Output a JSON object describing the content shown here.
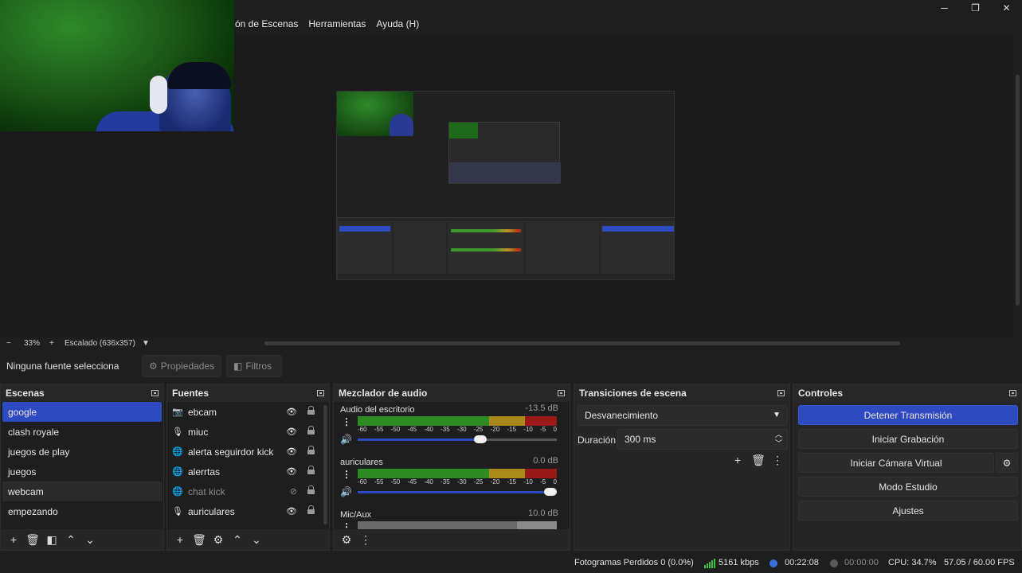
{
  "menu": {
    "items": [
      "ón de Escenas",
      "Herramientas",
      "Ayuda (H)"
    ]
  },
  "window_controls": {
    "minimize": "─",
    "restore": "❐",
    "close": "✕"
  },
  "zoom": {
    "minus": "−",
    "level": "33%",
    "plus": "+",
    "scaling": "Escalado (636x357)"
  },
  "source_toolbar": {
    "no_selection": "Ninguna fuente selecciona",
    "properties": "Propiedades",
    "filters": "Filtros"
  },
  "scenes": {
    "title": "Escenas",
    "items": [
      "google",
      "clash royale",
      "juegos de play",
      "juegos",
      "webcam",
      "empezando"
    ],
    "active_index": 0
  },
  "sources": {
    "title": "Fuentes",
    "items": [
      {
        "name": "ebcam",
        "icon": "camera-icon",
        "visible": true
      },
      {
        "name": "miuc",
        "icon": "microphone-icon",
        "visible": true
      },
      {
        "name": "alerta seguirdor kick",
        "icon": "browser-icon",
        "visible": true
      },
      {
        "name": "alerrtas",
        "icon": "browser-icon",
        "visible": true
      },
      {
        "name": "chat kick",
        "icon": "browser-icon",
        "visible": false
      },
      {
        "name": "auriculares",
        "icon": "microphone-icon",
        "visible": true
      }
    ]
  },
  "mixer": {
    "title": "Mezclador de audio",
    "ticks": [
      "-60",
      "-55",
      "-50",
      "-45",
      "-40",
      "-35",
      "-30",
      "-25",
      "-20",
      "-15",
      "-10",
      "-5",
      "0"
    ],
    "channels": [
      {
        "name": "Audio del escritorio",
        "db": "-13.5 dB",
        "fader": 0.6
      },
      {
        "name": "auriculares",
        "db": "0.0 dB",
        "fader": 1.0
      },
      {
        "name": "Mic/Aux",
        "db": "10.0 dB"
      }
    ]
  },
  "transitions": {
    "title": "Transiciones de escena",
    "selected": "Desvanecimiento",
    "duration_label": "Duración",
    "duration_value": "300 ms"
  },
  "controls": {
    "title": "Controles",
    "stop_stream": "Detener Transmisión",
    "start_recording": "Iniciar Grabación",
    "start_virtual_cam": "Iniciar Cámara Virtual",
    "studio_mode": "Modo Estudio",
    "settings": "Ajustes"
  },
  "status": {
    "dropped_frames": "Fotogramas Perdidos 0 (0.0%)",
    "bitrate": "5161 kbps",
    "stream_time": "00:22:08",
    "record_time": "00:00:00",
    "cpu": "CPU: 34.7%",
    "fps": "57.05 / 60.00 FPS"
  },
  "colors": {
    "accent": "#2d4ac0",
    "background": "#1e1e1e",
    "panel": "#262626",
    "meter_green": "#2e8a22",
    "meter_yellow": "#a98a1a",
    "meter_red": "#9a1a1a"
  }
}
